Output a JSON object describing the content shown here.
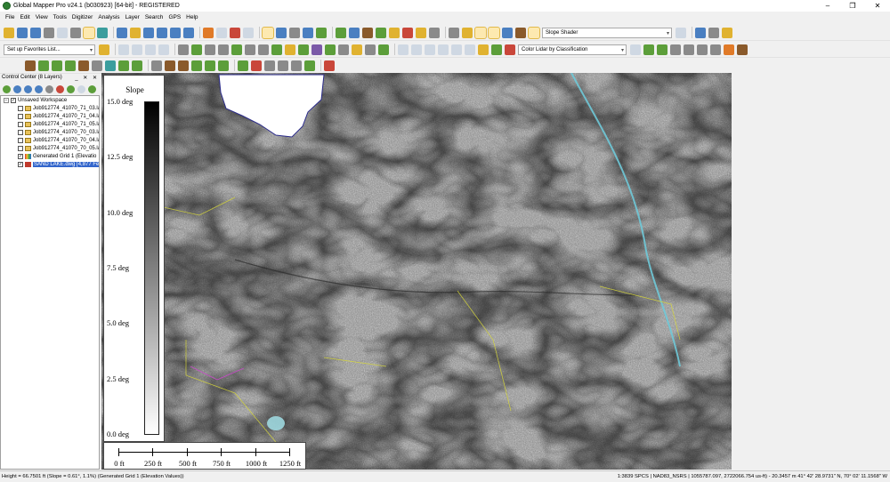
{
  "window": {
    "title": "Global Mapper Pro v24.1 (b030923) [64-bit] - REGISTERED",
    "controls": [
      "–",
      "❐",
      "✕"
    ]
  },
  "menu": [
    "File",
    "Edit",
    "View",
    "Tools",
    "Digitizer",
    "Analysis",
    "Layer",
    "Search",
    "GPS",
    "Help"
  ],
  "toolbar": {
    "shader_select": "Slope Shader",
    "favorites_select": "Set up Favorites List...",
    "lidar_color_select": "Color Lidar by Classification"
  },
  "control_center": {
    "title": "Control Center (8 Layers)",
    "controls": "_ ✕ ✕",
    "workspace": "Unsaved Workspace",
    "layers": [
      {
        "name": "Job912774_41070_71_03.la",
        "checked": false,
        "icon": "las"
      },
      {
        "name": "Job912774_41070_71_04.la",
        "checked": false,
        "icon": "las"
      },
      {
        "name": "Job912774_41070_71_05.la",
        "checked": false,
        "icon": "las"
      },
      {
        "name": "Job912774_41070_70_03.la",
        "checked": false,
        "icon": "las"
      },
      {
        "name": "Job912774_41070_70_04.la",
        "checked": false,
        "icon": "las"
      },
      {
        "name": "Job912774_41070_70_05.la",
        "checked": false,
        "icon": "las"
      },
      {
        "name": "Generated Grid 1 (Elevatio",
        "checked": true,
        "icon": "grid"
      },
      {
        "name": "SAND LAKE.dwg [4,877 Fe",
        "checked": true,
        "icon": "dwg",
        "selected": true
      }
    ]
  },
  "legend": {
    "title": "Slope",
    "ticks": [
      "15.0 deg",
      "12.5 deg",
      "10.0 deg",
      "7.5 deg",
      "5.0 deg",
      "2.5 deg",
      "0.0 deg"
    ]
  },
  "scale_bar": {
    "labels": [
      "0 ft",
      "250 ft",
      "500 ft",
      "750 ft",
      "1000 ft",
      "1250 ft"
    ]
  },
  "status": {
    "left": "Height = 66.7501 ft (Slope = 0.61°, 1.1%) (Generated Grid 1 (Elevation Values))",
    "right": "1:3839  SPCS | NAD83_NSRS | 1055787.097, 2722066.754 us-ft) - 20.3457 m  41° 42' 28.9731\" N, 70° 02' 11.1568\" W"
  }
}
